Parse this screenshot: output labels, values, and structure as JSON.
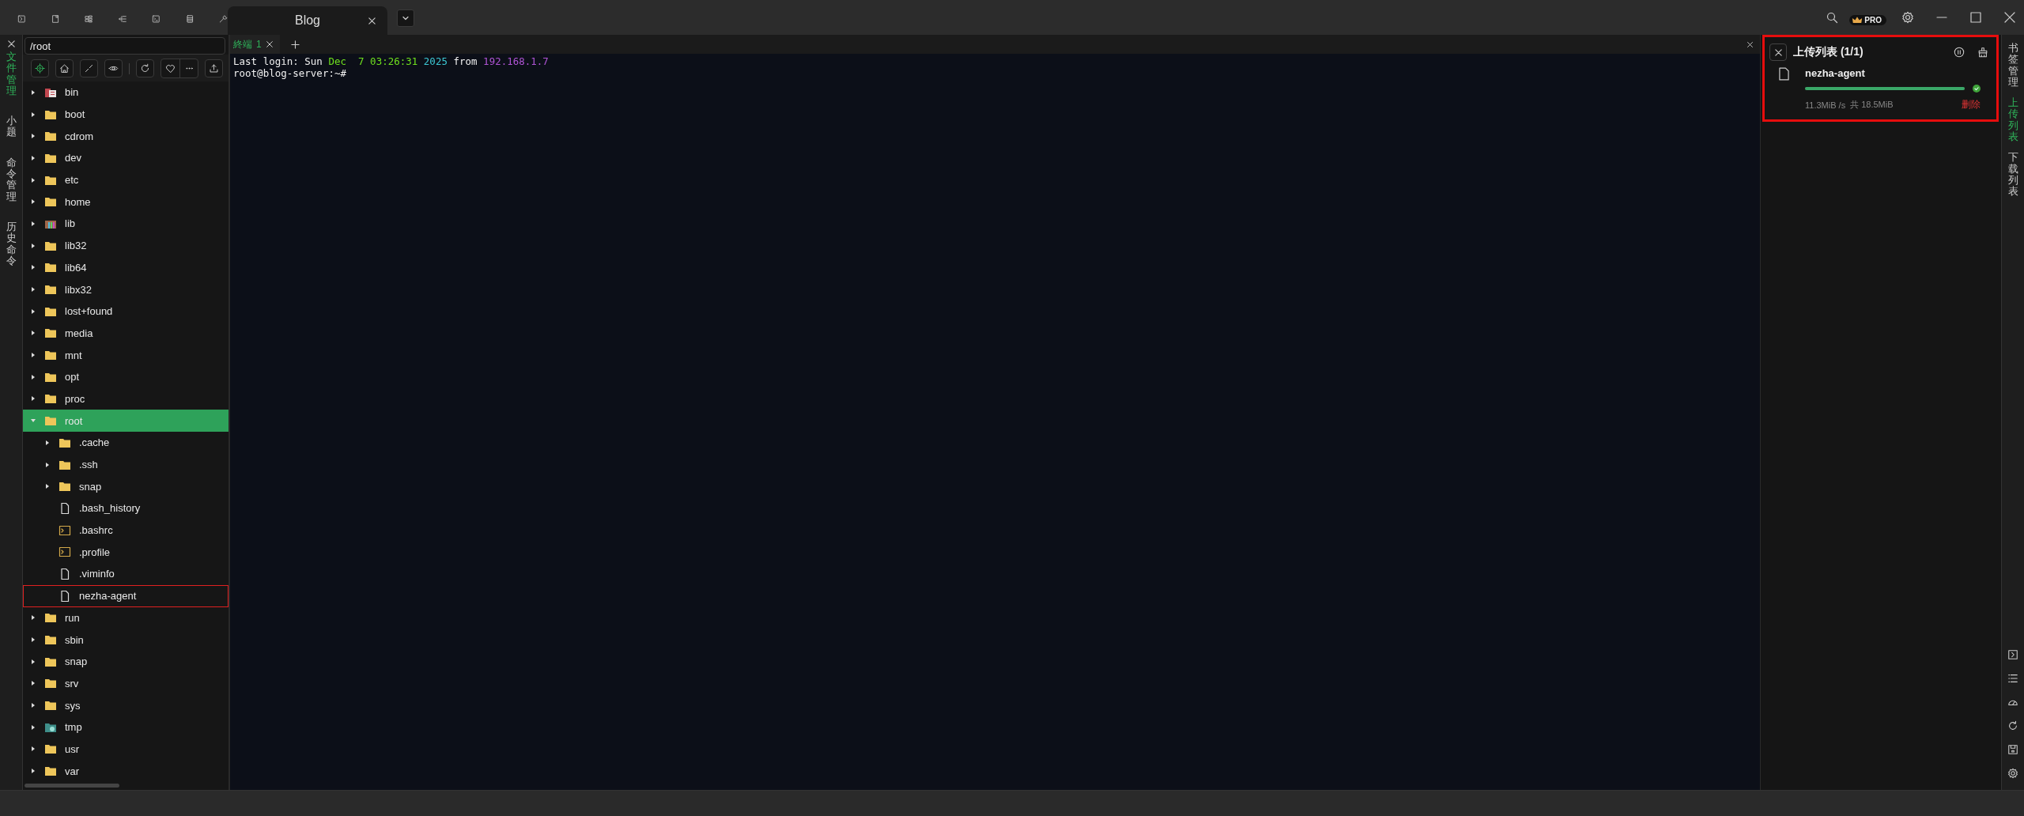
{
  "session_tabs": [
    {
      "label": "Blog",
      "selected": true
    }
  ],
  "badge": "PRO",
  "left_tabs": [
    {
      "label": "文件管理",
      "selected": true
    },
    {
      "label": "小题",
      "selected": false
    },
    {
      "label": "命令管理",
      "selected": false
    },
    {
      "label": "历史命令",
      "selected": false
    }
  ],
  "file_manager": {
    "path": "/root",
    "tree": [
      {
        "name": "bin",
        "kind": "bin",
        "expanded": false,
        "selected": false,
        "highlighted": false
      },
      {
        "name": "boot",
        "kind": "folder",
        "expanded": false,
        "selected": false,
        "highlighted": false
      },
      {
        "name": "cdrom",
        "kind": "folder",
        "expanded": false,
        "selected": false,
        "highlighted": false
      },
      {
        "name": "dev",
        "kind": "folder",
        "expanded": false,
        "selected": false,
        "highlighted": false
      },
      {
        "name": "etc",
        "kind": "folder",
        "expanded": false,
        "selected": false,
        "highlighted": false
      },
      {
        "name": "home",
        "kind": "folder",
        "expanded": false,
        "selected": false,
        "highlighted": false
      },
      {
        "name": "lib",
        "kind": "lib",
        "expanded": false,
        "selected": false,
        "highlighted": false
      },
      {
        "name": "lib32",
        "kind": "folder",
        "expanded": false,
        "selected": false,
        "highlighted": false
      },
      {
        "name": "lib64",
        "kind": "folder",
        "expanded": false,
        "selected": false,
        "highlighted": false
      },
      {
        "name": "libx32",
        "kind": "folder",
        "expanded": false,
        "selected": false,
        "highlighted": false
      },
      {
        "name": "lost+found",
        "kind": "folder",
        "expanded": false,
        "selected": false,
        "highlighted": false
      },
      {
        "name": "media",
        "kind": "folder",
        "expanded": false,
        "selected": false,
        "highlighted": false
      },
      {
        "name": "mnt",
        "kind": "folder",
        "expanded": false,
        "selected": false,
        "highlighted": false
      },
      {
        "name": "opt",
        "kind": "folder",
        "expanded": false,
        "selected": false,
        "highlighted": false
      },
      {
        "name": "proc",
        "kind": "folder",
        "expanded": false,
        "selected": false,
        "highlighted": false
      },
      {
        "name": "root",
        "kind": "folder",
        "expanded": true,
        "selected": true,
        "highlighted": false,
        "children": [
          {
            "name": ".cache",
            "kind": "folder",
            "expanded": false,
            "selected": false,
            "highlighted": false
          },
          {
            "name": ".ssh",
            "kind": "folder",
            "expanded": false,
            "selected": false,
            "highlighted": false
          },
          {
            "name": "snap",
            "kind": "folder",
            "expanded": false,
            "selected": false,
            "highlighted": false
          },
          {
            "name": ".bash_history",
            "kind": "file",
            "selected": false,
            "highlighted": false
          },
          {
            "name": ".bashrc",
            "kind": "script",
            "selected": false,
            "highlighted": false
          },
          {
            "name": ".profile",
            "kind": "script",
            "selected": false,
            "highlighted": false
          },
          {
            "name": ".viminfo",
            "kind": "file",
            "selected": false,
            "highlighted": false
          },
          {
            "name": "nezha-agent",
            "kind": "file",
            "selected": false,
            "highlighted": true
          }
        ]
      },
      {
        "name": "run",
        "kind": "folder",
        "expanded": false,
        "selected": false,
        "highlighted": false
      },
      {
        "name": "sbin",
        "kind": "folder",
        "expanded": false,
        "selected": false,
        "highlighted": false
      },
      {
        "name": "snap",
        "kind": "folder",
        "expanded": false,
        "selected": false,
        "highlighted": false
      },
      {
        "name": "srv",
        "kind": "folder",
        "expanded": false,
        "selected": false,
        "highlighted": false
      },
      {
        "name": "sys",
        "kind": "folder",
        "expanded": false,
        "selected": false,
        "highlighted": false
      },
      {
        "name": "tmp",
        "kind": "tmp",
        "expanded": false,
        "selected": false,
        "highlighted": false
      },
      {
        "name": "usr",
        "kind": "folder",
        "expanded": false,
        "selected": false,
        "highlighted": false
      },
      {
        "name": "var",
        "kind": "folder",
        "expanded": false,
        "selected": false,
        "highlighted": false
      }
    ]
  },
  "terminal": {
    "tabs": [
      {
        "label": "終端",
        "number": "1",
        "selected": true
      }
    ],
    "lines": [
      [
        {
          "text": "Last login: Sun ",
          "color": "#f0f0f0"
        },
        {
          "text": "Dec  7 03:26:31",
          "color": "#6fe01e"
        },
        {
          "text": " 2025",
          "color": "#3cc8d4"
        },
        {
          "text": " from ",
          "color": "#f0f0f0"
        },
        {
          "text": "192.168.1.7",
          "color": "#b054d6"
        }
      ],
      [
        {
          "text": "root@blog-server:~#",
          "color": "#f0f0f0"
        }
      ]
    ]
  },
  "upload_panel": {
    "title": "上传列表 (1/1)",
    "highlighted": true,
    "items": [
      {
        "name": "nezha-agent",
        "level": 1,
        "completed": true,
        "speed": "11.3MiB /s",
        "total": "共 18.5MiB",
        "action": "删除"
      }
    ]
  },
  "right_tabs": [
    {
      "label": "书签管理",
      "selected": false
    },
    {
      "label": "上传列表",
      "selected": true
    },
    {
      "label": "下载列表",
      "selected": false
    }
  ]
}
